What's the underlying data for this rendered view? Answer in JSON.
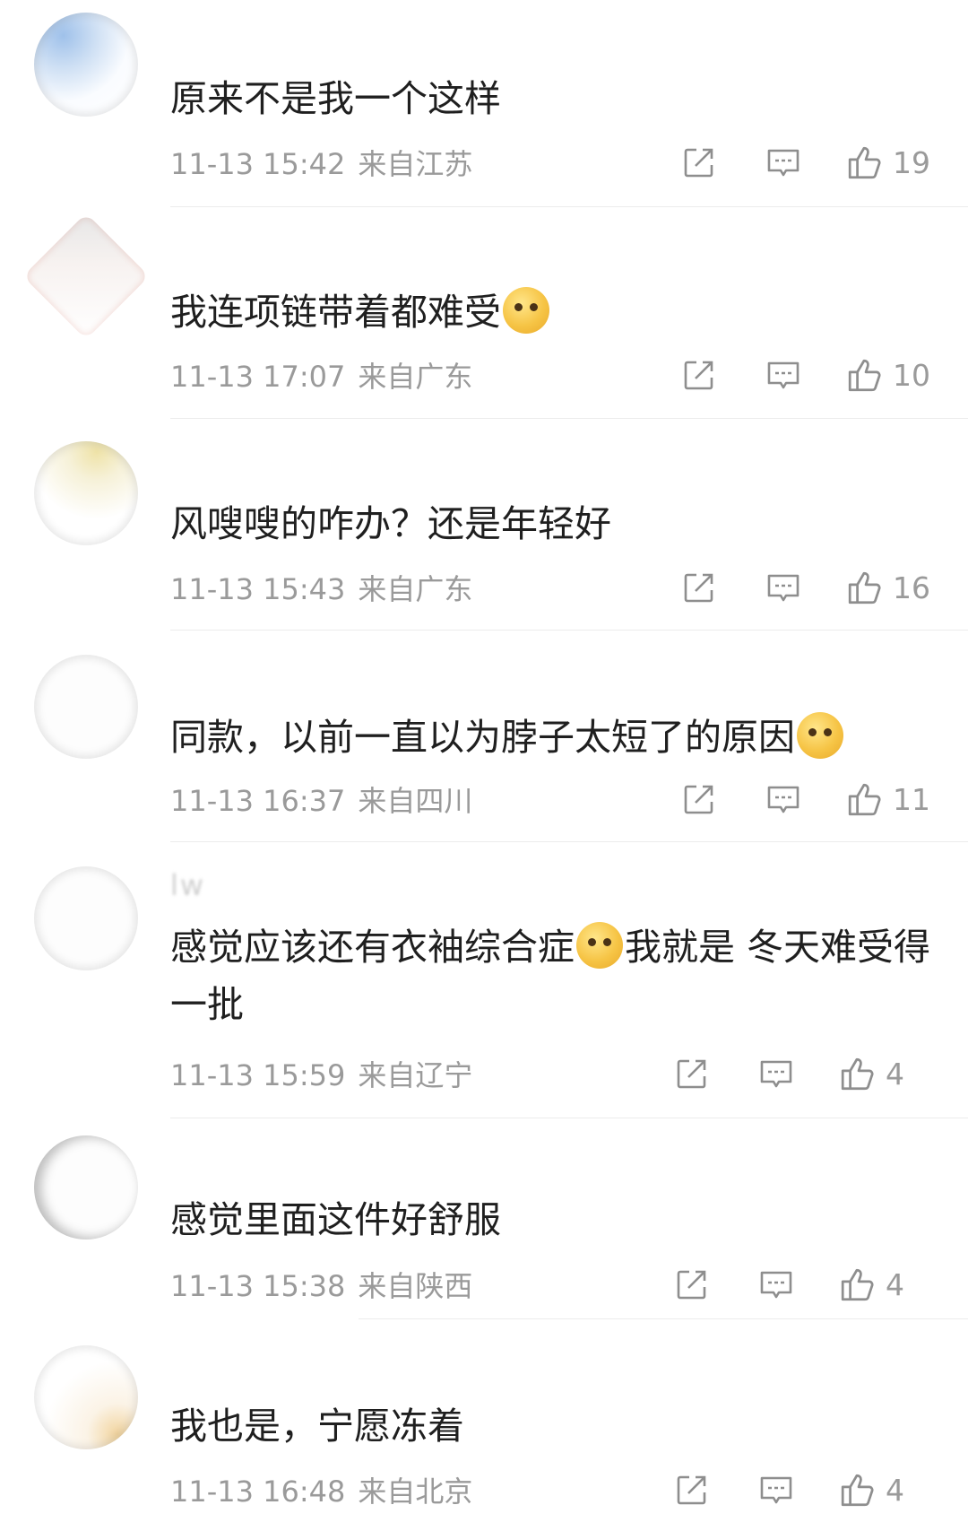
{
  "comments": [
    {
      "username": "原来不是我一个这样",
      "text": "原来不是我一个这样",
      "emoji_after": "",
      "time": "11-13 15:42",
      "location": "来自江苏",
      "likes": "19"
    },
    {
      "username": "",
      "text": "我连项链带着都难受",
      "emoji_after": "doge-emoji",
      "time": "11-13 17:07",
      "location": "来自广东",
      "likes": "10"
    },
    {
      "username": "",
      "text": "风嗖嗖的咋办？还是年轻好",
      "emoji_after": "",
      "time": "11-13 15:43",
      "location": "来自广东",
      "likes": "16"
    },
    {
      "username": "",
      "text": "同款，以前一直以为脖子太短了的原因",
      "emoji_after": "shy-emoji",
      "time": "11-13 16:37",
      "location": "来自四川",
      "likes": "11"
    },
    {
      "username": "lw",
      "text_before": "感觉应该还有衣袖综合症",
      "text_after": "我就是 冬天难受得一批",
      "emoji_mid": "crying-laugh-emoji",
      "time": "11-13 15:59",
      "location": "来自辽宁",
      "likes": "4"
    },
    {
      "username": "",
      "text": "感觉里面这件好舒服",
      "emoji_after": "",
      "time": "11-13 15:38",
      "location": "来自陕西",
      "likes": "4"
    },
    {
      "username": "",
      "text": "我也是，宁愿冻着",
      "emoji_after": "",
      "time": "11-13 16:48",
      "location": "来自北京",
      "likes": "4"
    }
  ],
  "icons": {
    "share": "share-icon",
    "reply": "reply-icon",
    "like": "thumbs-up-icon"
  },
  "colors": {
    "meta_text": "#9a9a9a",
    "content_text": "#1f1f1f",
    "divider": "#ececec"
  }
}
